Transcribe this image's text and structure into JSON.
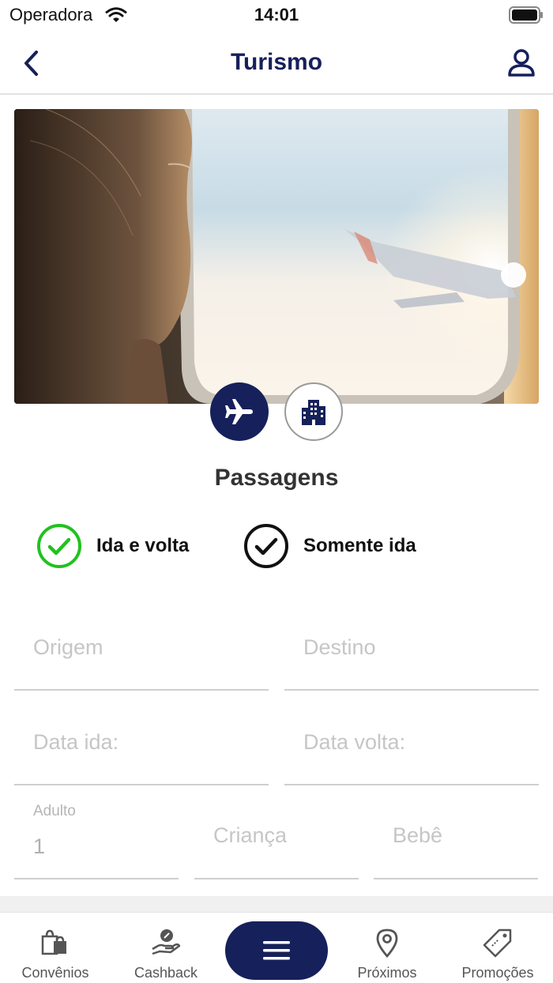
{
  "status_bar": {
    "carrier": "Operadora",
    "time": "14:01"
  },
  "nav": {
    "title": "Turismo",
    "back_icon": "chevron-left-icon",
    "profile_icon": "user-icon"
  },
  "mode_toggle": {
    "flight_icon": "airplane-icon",
    "hotel_icon": "building-icon",
    "selected": "flight"
  },
  "section_title": "Passagens",
  "trip_type": {
    "options": [
      {
        "label": "Ida e volta",
        "selected": true
      },
      {
        "label": "Somente ida",
        "selected": false
      }
    ]
  },
  "fields": {
    "origem_placeholder": "Origem",
    "destino_placeholder": "Destino",
    "data_ida_placeholder": "Data ida:",
    "data_volta_placeholder": "Data volta:",
    "adulto_label": "Adulto",
    "adulto_value": "1",
    "crianca_placeholder": "Criança",
    "bebe_placeholder": "Bebê"
  },
  "tab_bar": {
    "items": [
      {
        "label": "Convênios",
        "icon": "shopping-bags-icon"
      },
      {
        "label": "Cashback",
        "icon": "hand-coin-icon"
      },
      {
        "label": "Próximos",
        "icon": "map-pin-icon"
      },
      {
        "label": "Promoções",
        "icon": "price-tag-icon"
      }
    ],
    "menu_icon": "hamburger-menu-icon"
  },
  "colors": {
    "brand_navy": "#16205a",
    "selected_green": "#22c11f",
    "divider": "#cfcfcf",
    "placeholder": "#c6c6c6"
  }
}
